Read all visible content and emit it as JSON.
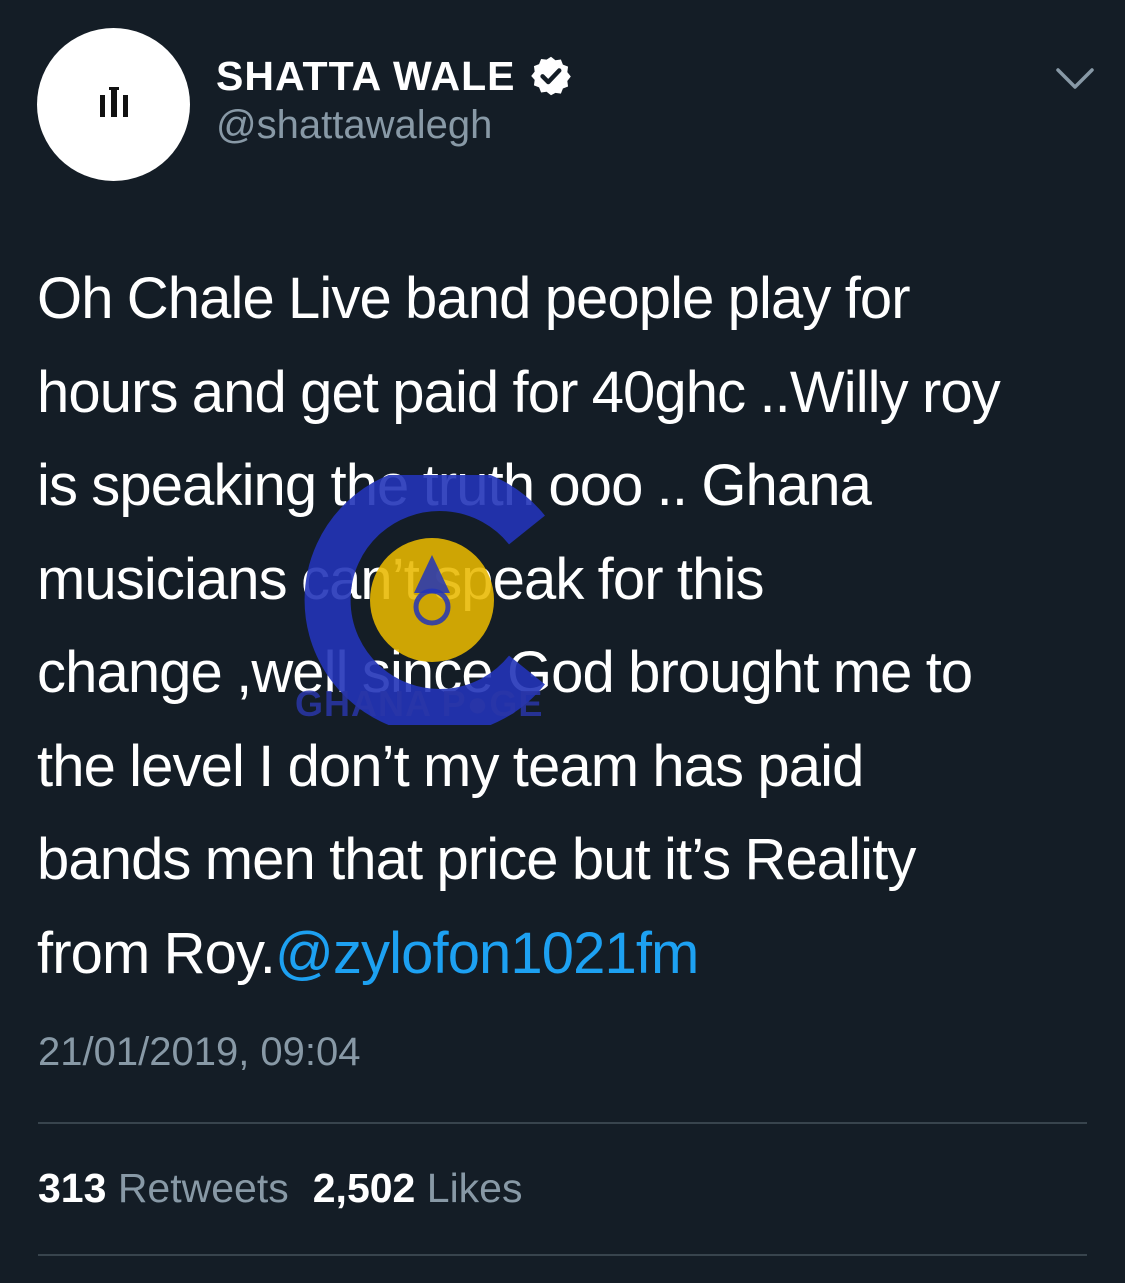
{
  "profile": {
    "display_name": "SHATTA WALE",
    "handle": "@shattawalegh",
    "verified": true,
    "avatar_icon": "crown-logo-icon"
  },
  "tweet": {
    "lines": [
      "Oh Chale Live band people play for",
      "hours and get paid for 40ghc ..Willy roy",
      "is speaking the truth ooo .. Ghana",
      "musicians can’t speak for this",
      "change ,well since God brought me to",
      "the level I don’t my team has paid",
      "bands men that price but it’s Reality",
      "from Roy."
    ],
    "mention": "@zylofon1021fm",
    "timestamp": "21/01/2019, 09:04"
  },
  "stats": {
    "retweets_count": "313",
    "retweets_label": "Retweets",
    "likes_count": "2,502",
    "likes_label": "Likes"
  },
  "watermark": {
    "text": "GHANA P●GE"
  },
  "colors": {
    "background": "#141d26",
    "text": "#ffffff",
    "secondary": "#8899a6",
    "link": "#1da1f2",
    "divider": "#38444d"
  }
}
